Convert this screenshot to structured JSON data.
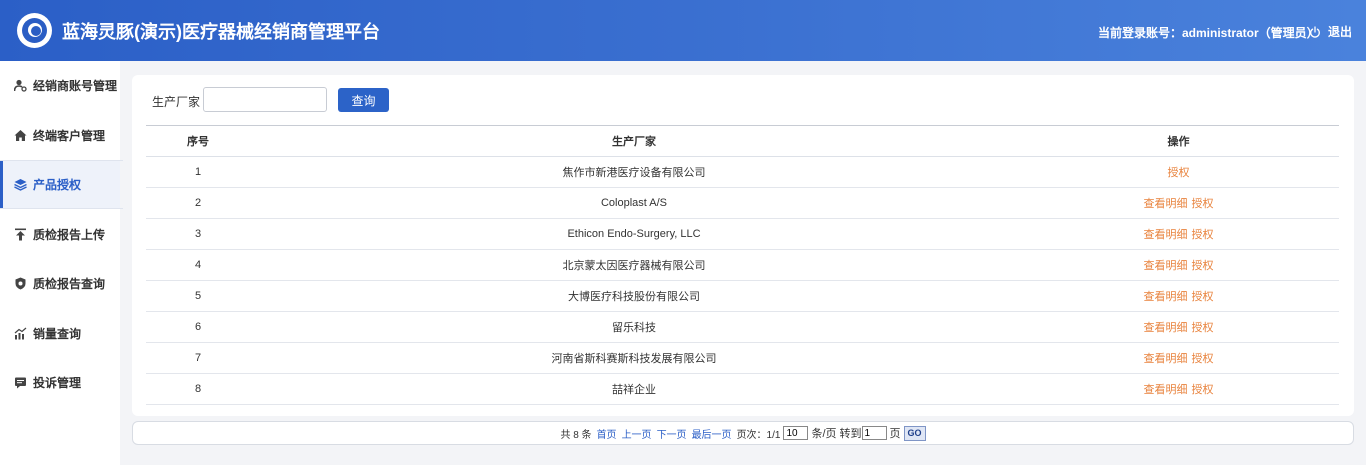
{
  "header": {
    "title": "蓝海灵豚(演示)医疗器械经销商管理平台",
    "user_info": "当前登录账号：administrator（管理员）",
    "logout_label": "退出"
  },
  "sidebar": {
    "items": [
      {
        "label": "经销商账号管理",
        "icon": "user-gear-icon"
      },
      {
        "label": "终端客户管理",
        "icon": "home-icon"
      },
      {
        "label": "产品授权",
        "icon": "layers-icon",
        "active": true
      },
      {
        "label": "质检报告上传",
        "icon": "upload-icon"
      },
      {
        "label": "质检报告查询",
        "icon": "shield-icon"
      },
      {
        "label": "销量查询",
        "icon": "bar-chart-icon"
      },
      {
        "label": "投诉管理",
        "icon": "message-icon"
      }
    ]
  },
  "search": {
    "label": "生产厂家",
    "value": "",
    "placeholder": "",
    "button_label": "查询"
  },
  "table": {
    "headers": [
      "序号",
      "生产厂家",
      "操作"
    ],
    "rows": [
      {
        "no": "1",
        "maker": "焦作市新港医疗设备有限公司",
        "view": "",
        "auth": "授权"
      },
      {
        "no": "2",
        "maker": "Coloplast A/S",
        "view": "查看明细",
        "auth": "授权"
      },
      {
        "no": "3",
        "maker": "Ethicon Endo-Surgery, LLC",
        "view": "查看明细",
        "auth": "授权"
      },
      {
        "no": "4",
        "maker": "北京蒙太因医疗器械有限公司",
        "view": "查看明细",
        "auth": "授权"
      },
      {
        "no": "5",
        "maker": "大博医疗科技股份有限公司",
        "view": "查看明细",
        "auth": "授权"
      },
      {
        "no": "6",
        "maker": "留乐科技",
        "view": "查看明细",
        "auth": "授权"
      },
      {
        "no": "7",
        "maker": "河南省斯科赛斯科技发展有限公司",
        "view": "查看明细",
        "auth": "授权"
      },
      {
        "no": "8",
        "maker": "喆祥企业",
        "view": "查看明细",
        "auth": "授权"
      }
    ]
  },
  "pager": {
    "total": "共 8 条",
    "first": "首页",
    "prev": "上一页",
    "next": "下一页",
    "last": "最后一页",
    "page_info": "页次：1/1",
    "page_size": "10",
    "per_page": "条/页",
    "goto": "转到",
    "goto_value": "1",
    "page_unit": "页",
    "go_label": "GO"
  },
  "colors": {
    "header_blue": "#2b5fc7",
    "link_orange": "#e8823c",
    "button_blue": "#2c63c8"
  }
}
